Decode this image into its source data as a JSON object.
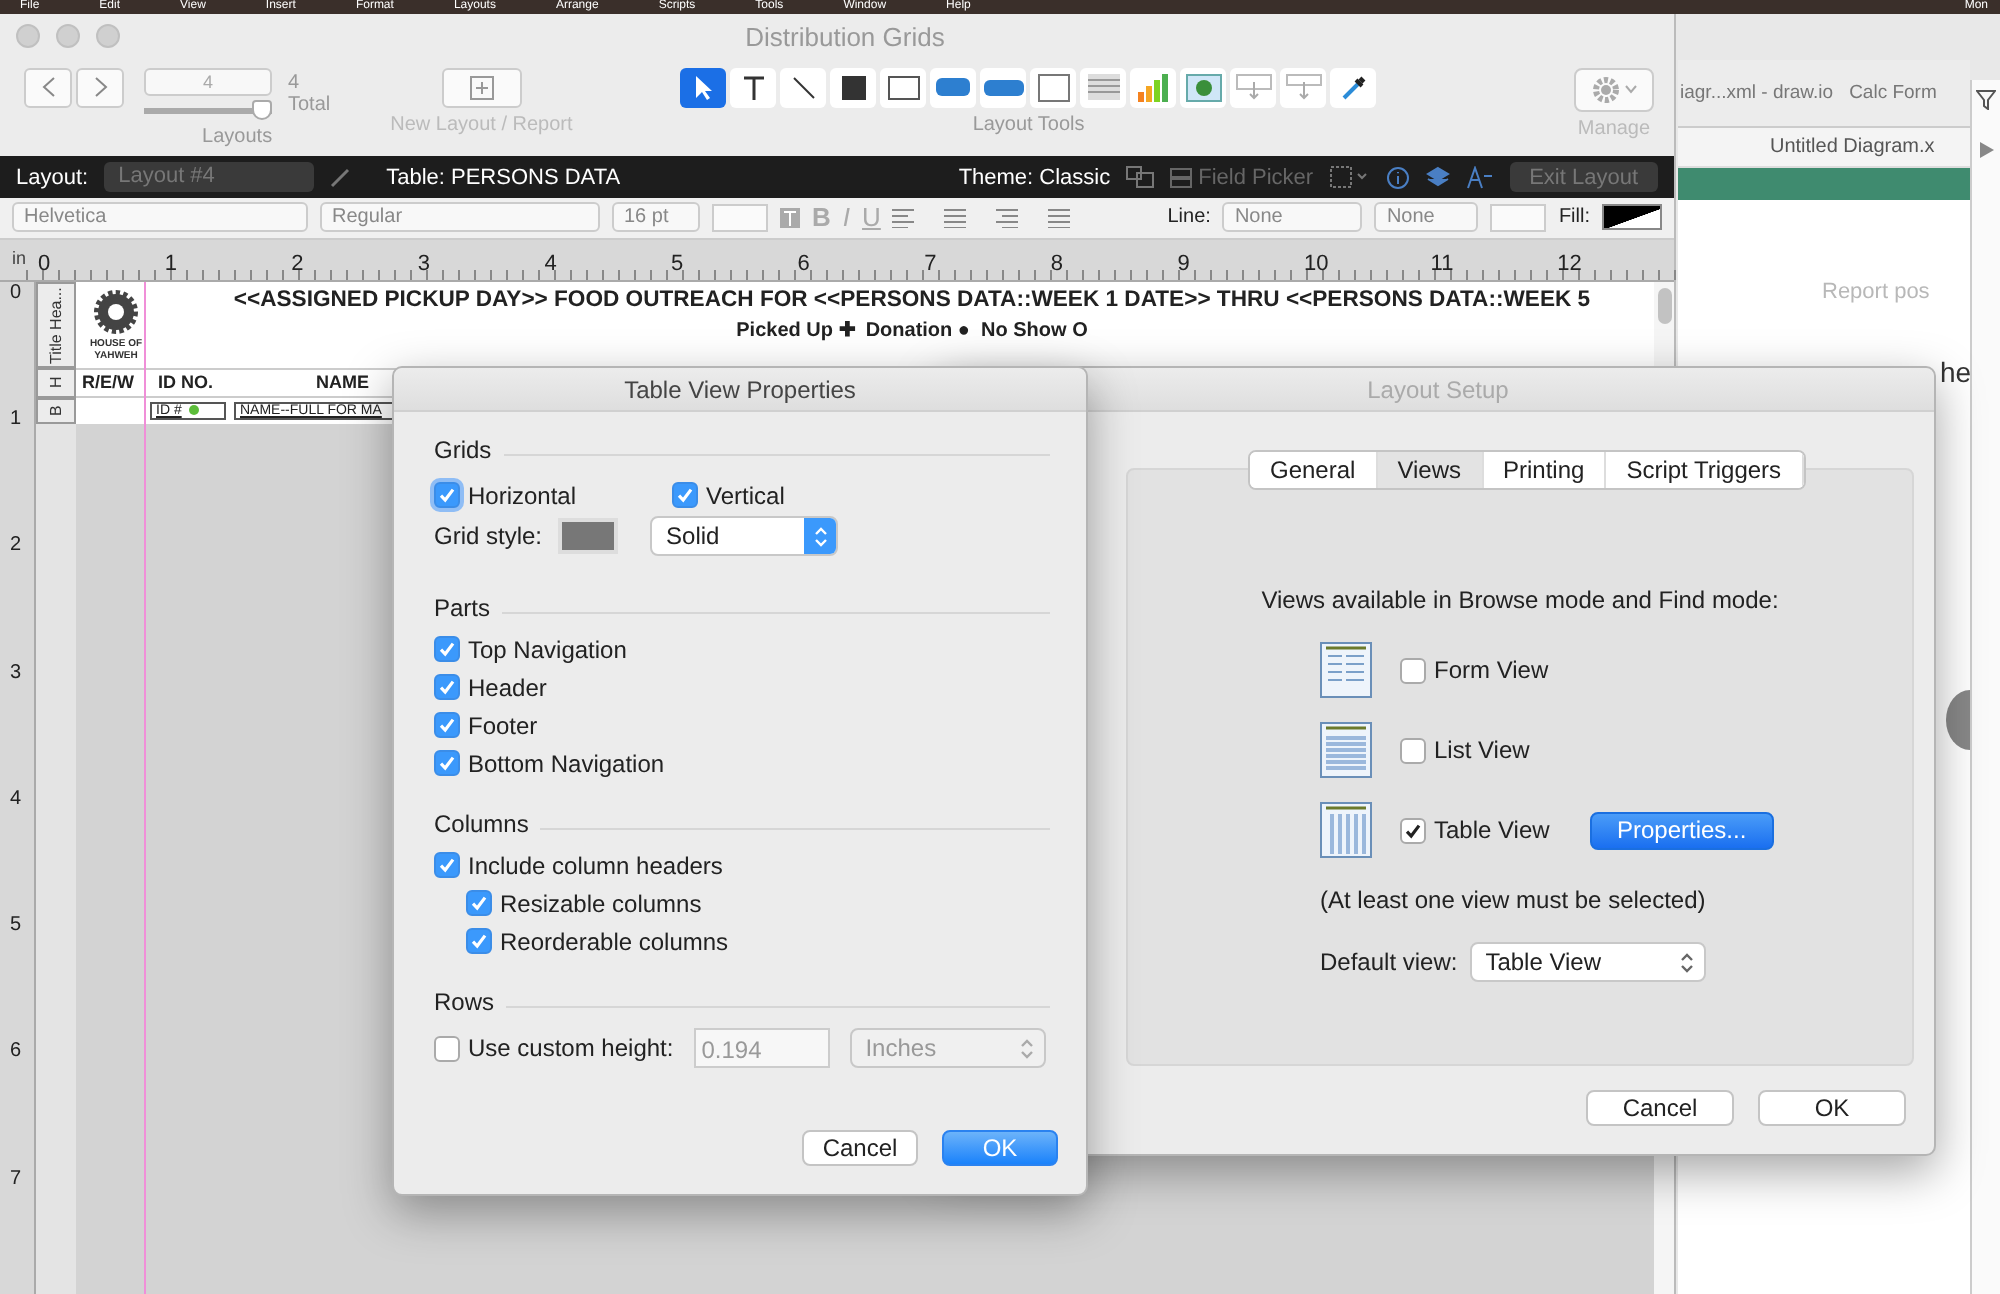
{
  "menu_bar": {
    "items": [
      "File",
      "Edit",
      "View",
      "Insert",
      "Format",
      "Layouts",
      "Arrange",
      "Scripts",
      "Tools",
      "Window",
      "Help"
    ],
    "right": "Mon"
  },
  "main_window": {
    "title": "Distribution Grids",
    "toolbar": {
      "layout_number": "4",
      "total_count": "4",
      "total_label": "Total",
      "layouts_label": "Layouts",
      "new_layout_label": "New Layout / Report",
      "tools_label": "Layout Tools",
      "manage_label": "Manage",
      "slider": {
        "level": 1
      },
      "tools": [
        {
          "kind": "pointer",
          "selected": true
        },
        {
          "kind": "text",
          "selected": false
        },
        {
          "kind": "line",
          "selected": false
        },
        {
          "kind": "shape",
          "selected": false
        },
        {
          "kind": "field",
          "selected": false
        },
        {
          "kind": "button",
          "selected": false
        },
        {
          "kind": "button-bar",
          "selected": false
        },
        {
          "kind": "portal",
          "selected": false
        },
        {
          "kind": "list",
          "selected": false
        },
        {
          "kind": "chart",
          "selected": false
        },
        {
          "kind": "web-viewer",
          "selected": false
        },
        {
          "kind": "insert-field",
          "selected": false
        },
        {
          "kind": "insert-part",
          "selected": false
        },
        {
          "kind": "eyedropper",
          "selected": false
        }
      ]
    },
    "layout_bar": {
      "layout_label": "Layout:",
      "layout_value": "Layout #4",
      "table": "Table: PERSONS DATA",
      "theme": "Theme: Classic",
      "field_picker": "Field Picker",
      "exit": "Exit Layout"
    },
    "format_bar": {
      "font": "Helvetica",
      "style": "Regular",
      "size": "16 pt",
      "bold": "B",
      "italic": "I",
      "underline": "U",
      "line_label": "Line:",
      "line_style": "None",
      "line_width": "None",
      "fill_label": "Fill:"
    },
    "ruler": {
      "unit": "in",
      "marks": [
        "0",
        "1",
        "2",
        "3",
        "4",
        "5",
        "6",
        "7",
        "8",
        "9",
        "10",
        "11",
        "12"
      ]
    },
    "vertical_ruler": [
      "0",
      "1",
      "2",
      "3",
      "4",
      "5",
      "6",
      "7"
    ],
    "parts": [
      "Title Hea...",
      "H",
      "B"
    ],
    "layout": {
      "logo_text": "HOUSE OF YAHWEH",
      "title": "<<ASSIGNED PICKUP DAY>> FOOD OUTREACH FOR <<PERSONS DATA::WEEK 1 DATE>> THRU <<PERSONS DATA::WEEK 5",
      "legend": "Picked Up ✚  Donation ●  No Show O",
      "headers": [
        "R/E/W",
        "ID NO.",
        "NAME"
      ],
      "fields": [
        "ID #",
        "NAME--FULL FOR MA"
      ]
    }
  },
  "table_view_properties": {
    "title": "Table View Properties",
    "grids": {
      "heading": "Grids",
      "horizontal": {
        "label": "Horizontal",
        "checked": true
      },
      "vertical": {
        "label": "Vertical",
        "checked": true
      },
      "style_label": "Grid style:",
      "style_value": "Solid"
    },
    "parts": {
      "heading": "Parts",
      "items": [
        {
          "label": "Top Navigation",
          "checked": true
        },
        {
          "label": "Header",
          "checked": true
        },
        {
          "label": "Footer",
          "checked": true
        },
        {
          "label": "Bottom Navigation",
          "checked": true
        }
      ]
    },
    "columns": {
      "heading": "Columns",
      "include_headers": {
        "label": "Include column headers",
        "checked": true
      },
      "options": [
        {
          "label": "Resizable columns",
          "checked": true
        },
        {
          "label": "Reorderable columns",
          "checked": true
        }
      ]
    },
    "rows": {
      "heading": "Rows",
      "custom_height": {
        "label": "Use custom height:",
        "checked": false
      },
      "height_value": "0.194",
      "unit": "Inches"
    },
    "buttons": {
      "cancel": "Cancel",
      "ok": "OK"
    }
  },
  "layout_setup": {
    "title": "Layout Setup",
    "tabs": [
      {
        "label": "General",
        "selected": false
      },
      {
        "label": "Views",
        "selected": true
      },
      {
        "label": "Printing",
        "selected": false
      },
      {
        "label": "Script Triggers",
        "selected": false
      }
    ],
    "intro": "Views available in Browse mode and Find mode:",
    "views": [
      {
        "kind": "form",
        "label": "Form View",
        "checked": false
      },
      {
        "kind": "list",
        "label": "List View",
        "checked": false
      },
      {
        "kind": "table",
        "label": "Table View",
        "checked": true
      }
    ],
    "properties_button": "Properties...",
    "note": "(At least one view must be selected)",
    "default_label": "Default view:",
    "default_value": "Table View",
    "buttons": {
      "cancel": "Cancel",
      "ok": "OK"
    }
  },
  "background_browser": {
    "tabs": [
      "iagr...xml - draw.io",
      "Calc Form"
    ],
    "active_tab": "Untitled Diagram.x",
    "faint_text": "Report pos",
    "heading_fragment": "he"
  }
}
